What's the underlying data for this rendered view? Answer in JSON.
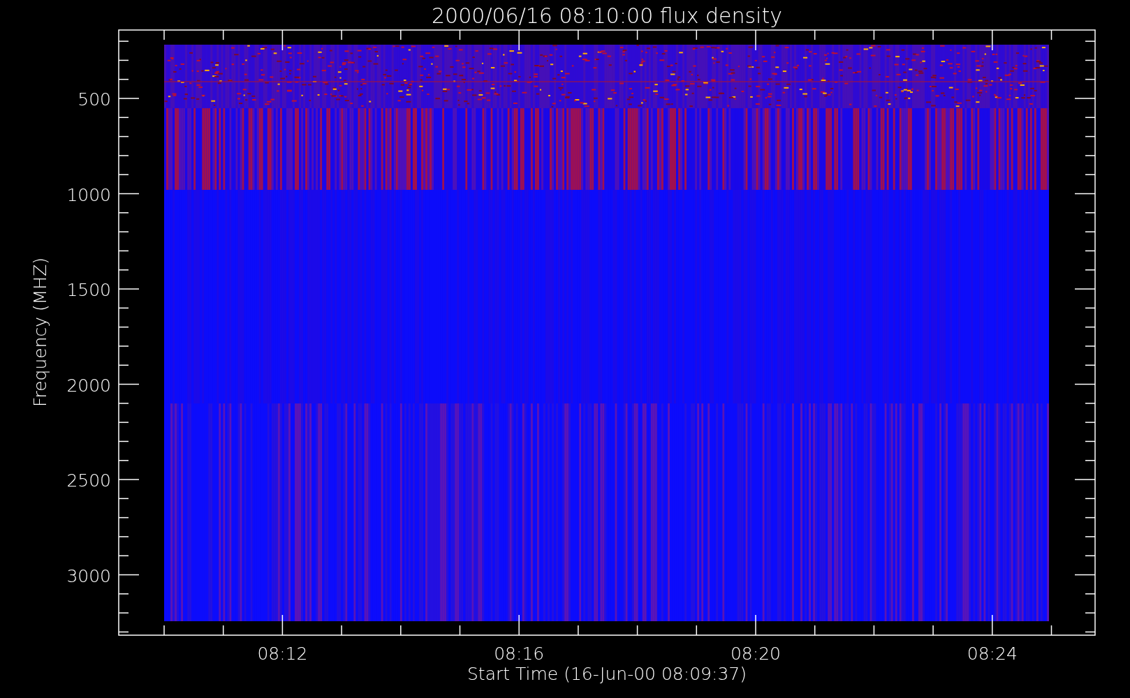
{
  "plot": {
    "title": "2000/06/16 08:10:00 flux density",
    "ylabel": "Frequency (MHZ)",
    "xlabel": "Start Time (16-Jun-00 08:09:37)",
    "y_tick_labels": [
      "500",
      "1000",
      "1500",
      "2000",
      "2500",
      "3000"
    ],
    "x_tick_labels": [
      "08:12",
      "08:16",
      "08:20",
      "08:24"
    ]
  }
}
